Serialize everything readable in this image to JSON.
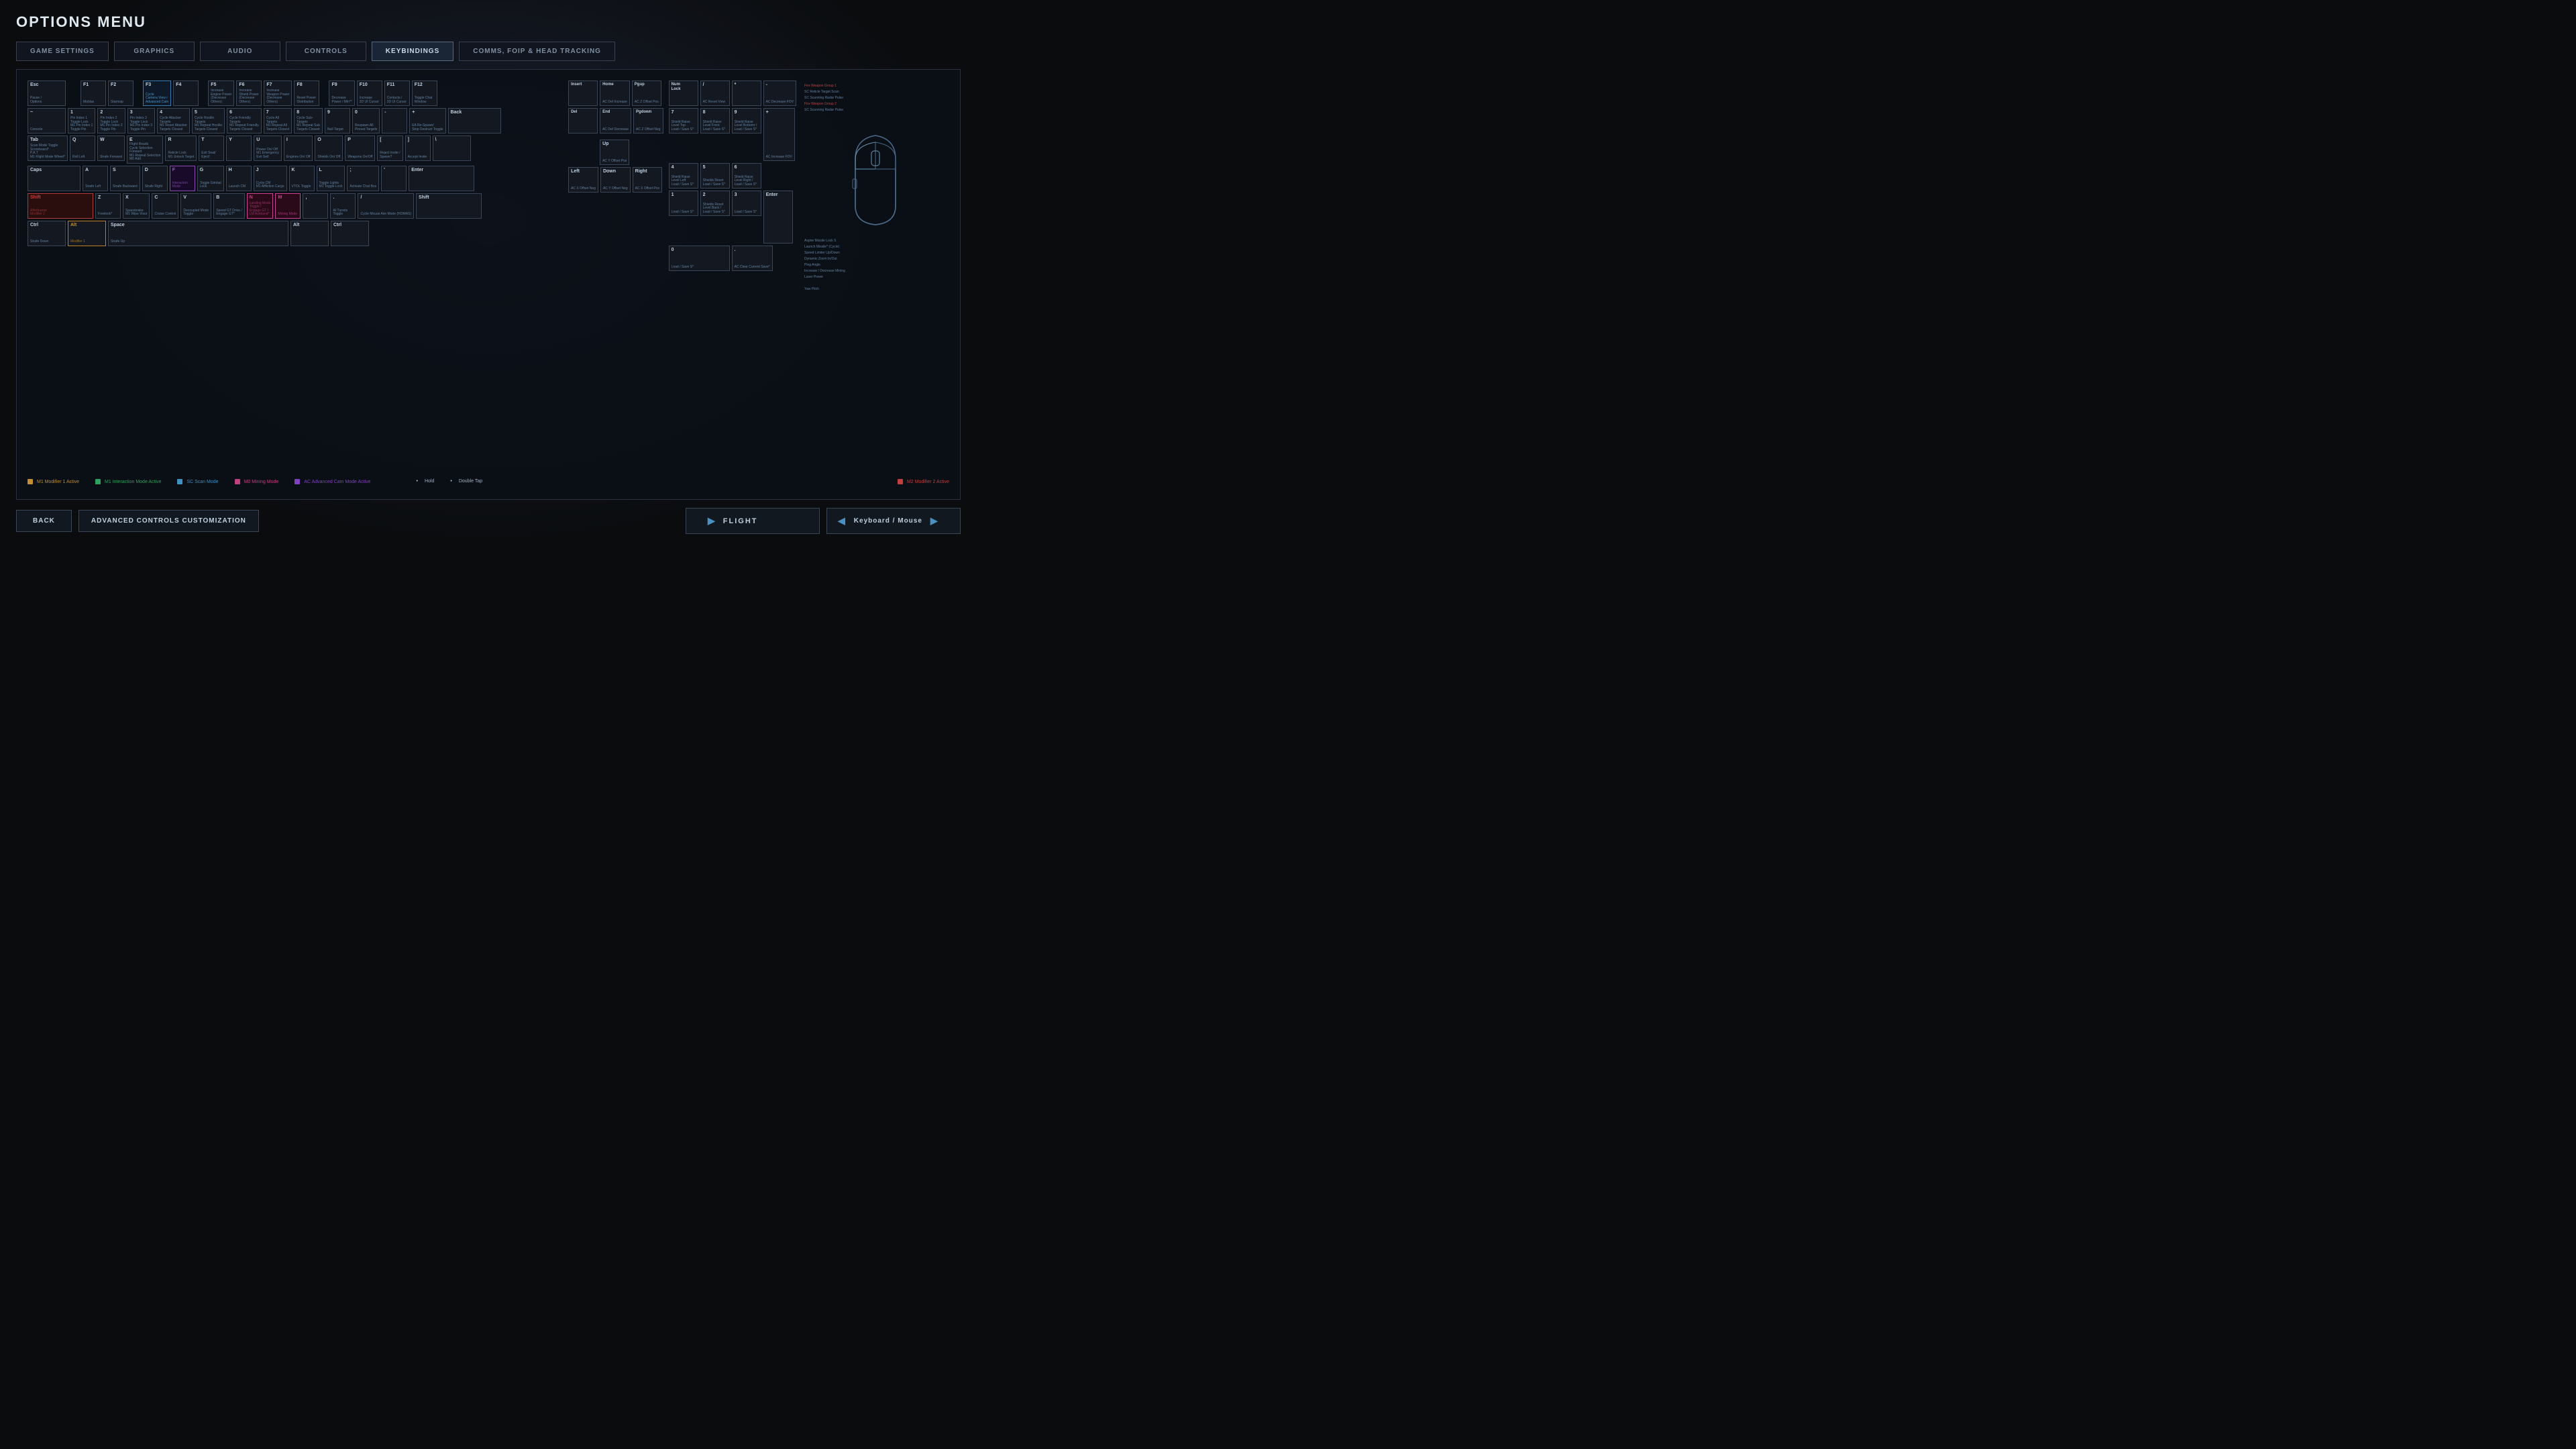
{
  "page": {
    "title": "OPTIONS MENU"
  },
  "nav": {
    "tabs": [
      {
        "label": "GAME SETTINGS",
        "active": false
      },
      {
        "label": "GRAPHICS",
        "active": false
      },
      {
        "label": "AUDIO",
        "active": false
      },
      {
        "label": "CONTROLS",
        "active": false
      },
      {
        "label": "KEYBINDINGS",
        "active": true
      },
      {
        "label": "COMMS, FOIP & HEAD TRACKING",
        "active": false
      }
    ]
  },
  "bottom": {
    "back_label": "BACK",
    "advanced_label": "ADVANCED CONTROLS CUSTOMIZATION",
    "flight_label": "FLIGHT",
    "keyboard_mouse_label": "Keyboard / Mouse"
  },
  "legend": {
    "m1": "M1  Modifier 1 Active",
    "m1_sub": "M1  Interaction Mode Active",
    "sc": "SC  Scan Mode",
    "m0": "M0  Mining Mode",
    "ac": "AC  Advanced Cam Mode Active",
    "hold": "Hold",
    "double_tap": "Double Tap",
    "m2": "M2  Modifier 2 Active"
  }
}
